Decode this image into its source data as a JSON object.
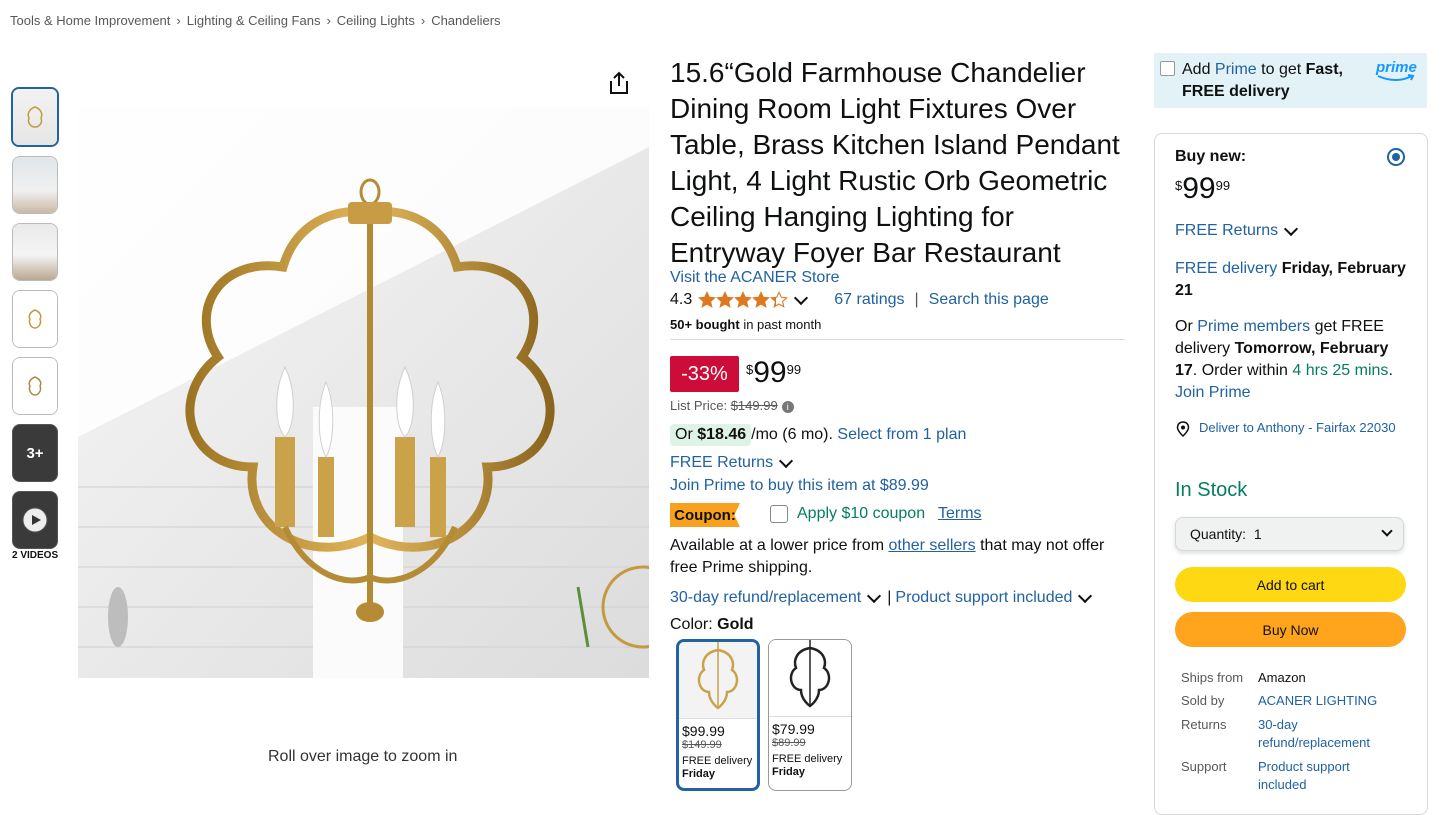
{
  "breadcrumb": [
    "Tools & Home Improvement",
    "Lighting & Ceiling Fans",
    "Ceiling Lights",
    "Chandeliers"
  ],
  "breadcrumb_separator": "›",
  "gallery": {
    "more_label": "3+",
    "videos_label": "2 VIDEOS",
    "zoom_hint": "Roll over image to zoom in"
  },
  "product": {
    "title": "15.6“Gold Farmhouse Chandelier Dining Room Light Fixtures Over Table, Brass Kitchen Island Pendant Light, 4 Light Rustic Orb Geometric Ceiling Hanging Lighting for Entryway Foyer Bar Restaurant",
    "store_link": "Visit the ACANER Store",
    "rating": "4.3",
    "rating_value": 4.3,
    "ratings_count": "67 ratings",
    "ratings_sep": "|",
    "search_page": "Search this page",
    "bought_bold": "50+ bought",
    "bought_rest": " in past month",
    "discount": "-33%",
    "price_symbol": "$",
    "price_whole": "99",
    "price_fraction": "99",
    "list_price_label": "List Price: ",
    "list_price": "$149.99",
    "monthly_prefix": "Or ",
    "monthly_amount": "$18.46",
    "monthly_suffix": " /mo (6 mo).",
    "monthly_link": "Select from 1 plan",
    "free_returns": "FREE Returns",
    "join_prime_offer": "Join Prime to buy this item at $89.99",
    "coupon_badge": "Coupon:",
    "coupon_text": "Apply $10 coupon",
    "coupon_terms": "Terms",
    "lower_price_1": "Available at a lower price from ",
    "lower_price_link": "other sellers",
    "lower_price_2": " that may not offer free Prime shipping.",
    "refund_link": "30-day refund/replacement",
    "refund_sep": "|",
    "support_link": "Product support included",
    "color_label": "Color: ",
    "color_value": "Gold",
    "swatches": [
      {
        "price": "$99.99",
        "list": "$149.99",
        "delivery": "FREE delivery",
        "day": "Friday",
        "color": "#c9a24a"
      },
      {
        "price": "$79.99",
        "list": "$89.99",
        "delivery": "FREE delivery",
        "day": "Friday",
        "color": "#222222"
      }
    ]
  },
  "buybox": {
    "prime_banner_prefix": "Add ",
    "prime_banner_prime": "Prime",
    "prime_banner_mid": " to get ",
    "prime_banner_bold": "Fast, FREE delivery",
    "prime_logo": "prime",
    "buy_new": "Buy new:",
    "price_symbol": "$",
    "price_whole": "99",
    "price_fraction": "99",
    "free_returns": "FREE Returns",
    "delivery_link": "FREE delivery",
    "delivery_date": " Friday, February 21",
    "prime_or": "Or ",
    "prime_members": "Prime members",
    "prime_get": " get FREE delivery ",
    "prime_date": "Tomorrow, February 17",
    "prime_order": ". Order within ",
    "prime_countdown": "4 hrs 25 mins",
    "prime_period": ".",
    "join_prime": "Join Prime",
    "deliver_to": "Deliver to Anthony - Fairfax 22030",
    "stock": "In Stock",
    "quantity_label": "Quantity:",
    "quantity_value": "1",
    "add_to_cart": "Add to cart",
    "buy_now": "Buy Now",
    "ships_from_label": "Ships from",
    "ships_from": "Amazon",
    "sold_by_label": "Sold by",
    "sold_by": "ACANER LIGHTING",
    "returns_label": "Returns",
    "returns": "30-day refund/replacement",
    "support_label": "Support",
    "support": "Product support included"
  },
  "colors": {
    "link": "#2162a1",
    "discount": "#cc0c39",
    "coupon": "#f7a11e",
    "add_to_cart": "#ffd814",
    "buy_now": "#ffa41c",
    "stock": "#067d62",
    "star": "#de7921"
  }
}
